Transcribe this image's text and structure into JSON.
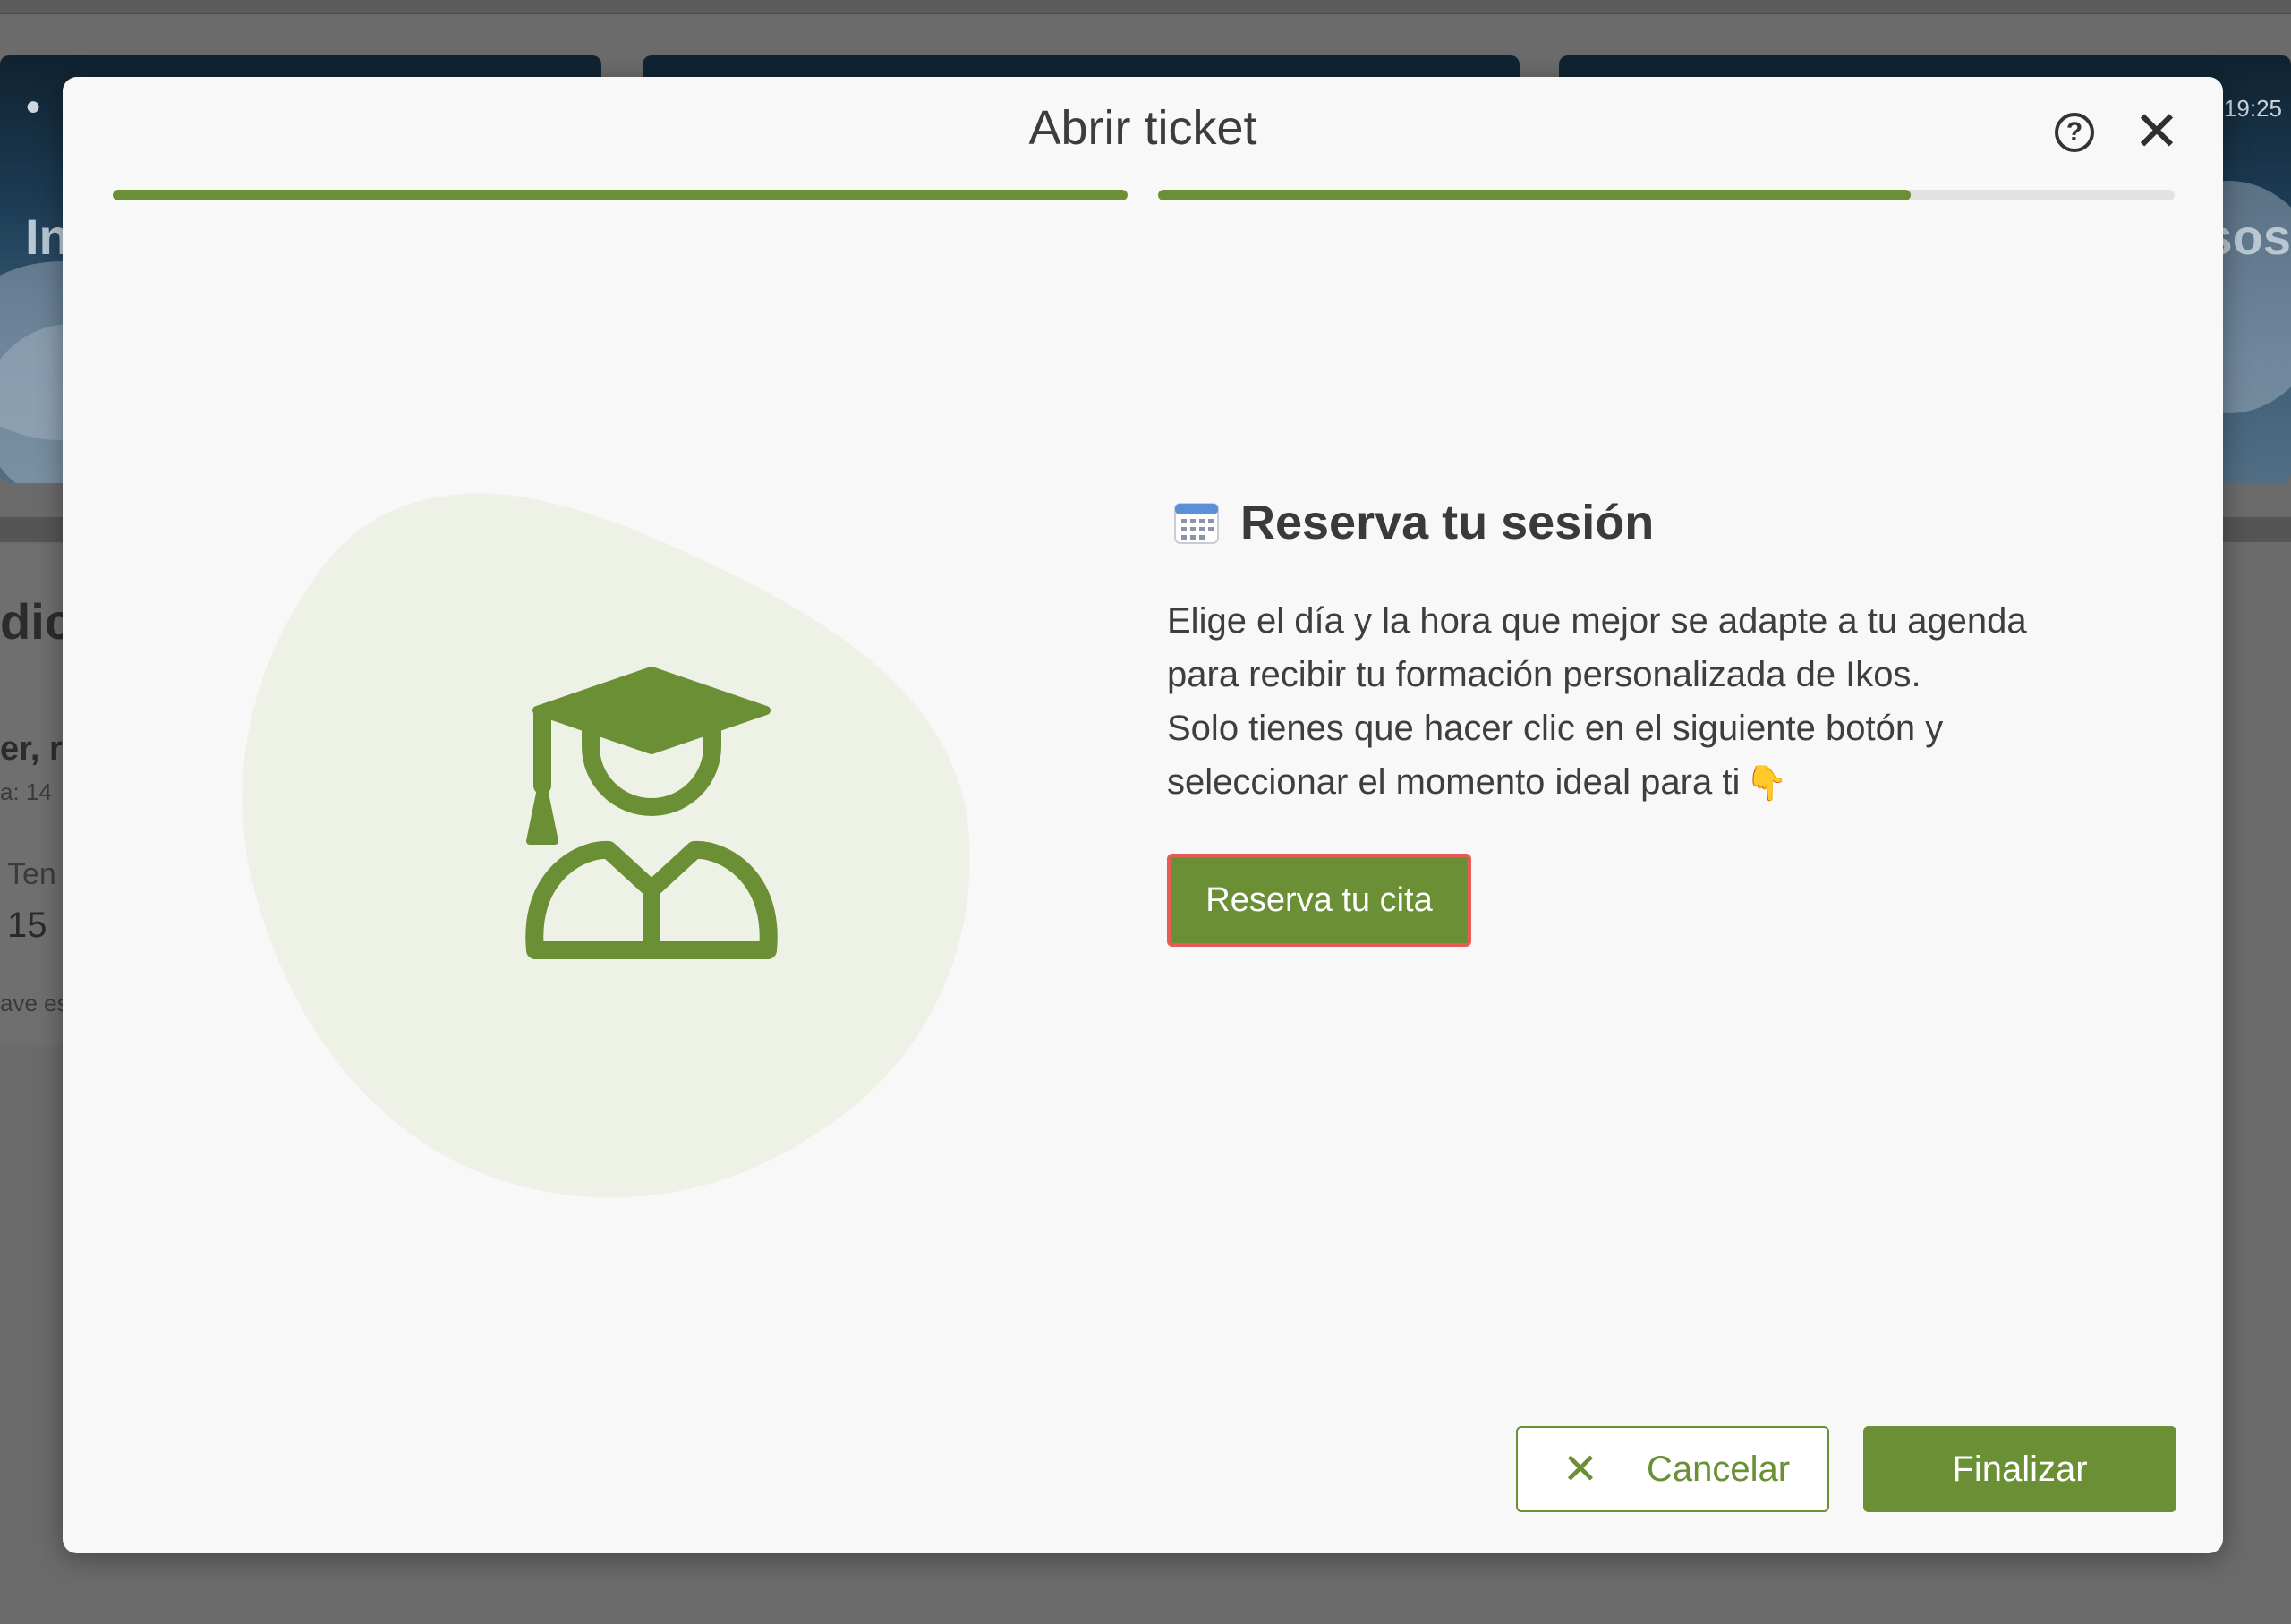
{
  "background": {
    "card_left_time": "",
    "card_right_time": "19:25",
    "card_left_text": "In",
    "card_right_text": "sos",
    "side_heading": "dic",
    "side_sub": "er, r",
    "side_meta": "a: 14",
    "side_label": "Ten",
    "side_value": "15",
    "side_footer": "ave es"
  },
  "modal": {
    "title": "Abrir ticket",
    "progress": [
      1.0,
      0.74
    ],
    "section_title": "Reserva tu sesión",
    "description": [
      "Elige el día y la hora que mejor se adapte a tu agenda",
      "para recibir tu formación personalizada de Ikos.",
      "Solo tienes que hacer clic en el siguiente botón y",
      "seleccionar el momento ideal para ti"
    ],
    "reserve_button": "Reserva tu cita",
    "cancel_button": "Cancelar",
    "finish_button": "Finalizar"
  },
  "icons": {
    "help": "help-circle-icon",
    "close": "close-icon",
    "calendar": "calendar-icon",
    "graduate": "graduate-user-icon",
    "pointing_down": "pointing-down-hand-icon",
    "cancel_x": "x-icon"
  },
  "colors": {
    "accent": "#6a8f35",
    "blob": "#eef2e6",
    "highlight_border": "#e85c57",
    "overlay": "#6b6b6b"
  }
}
